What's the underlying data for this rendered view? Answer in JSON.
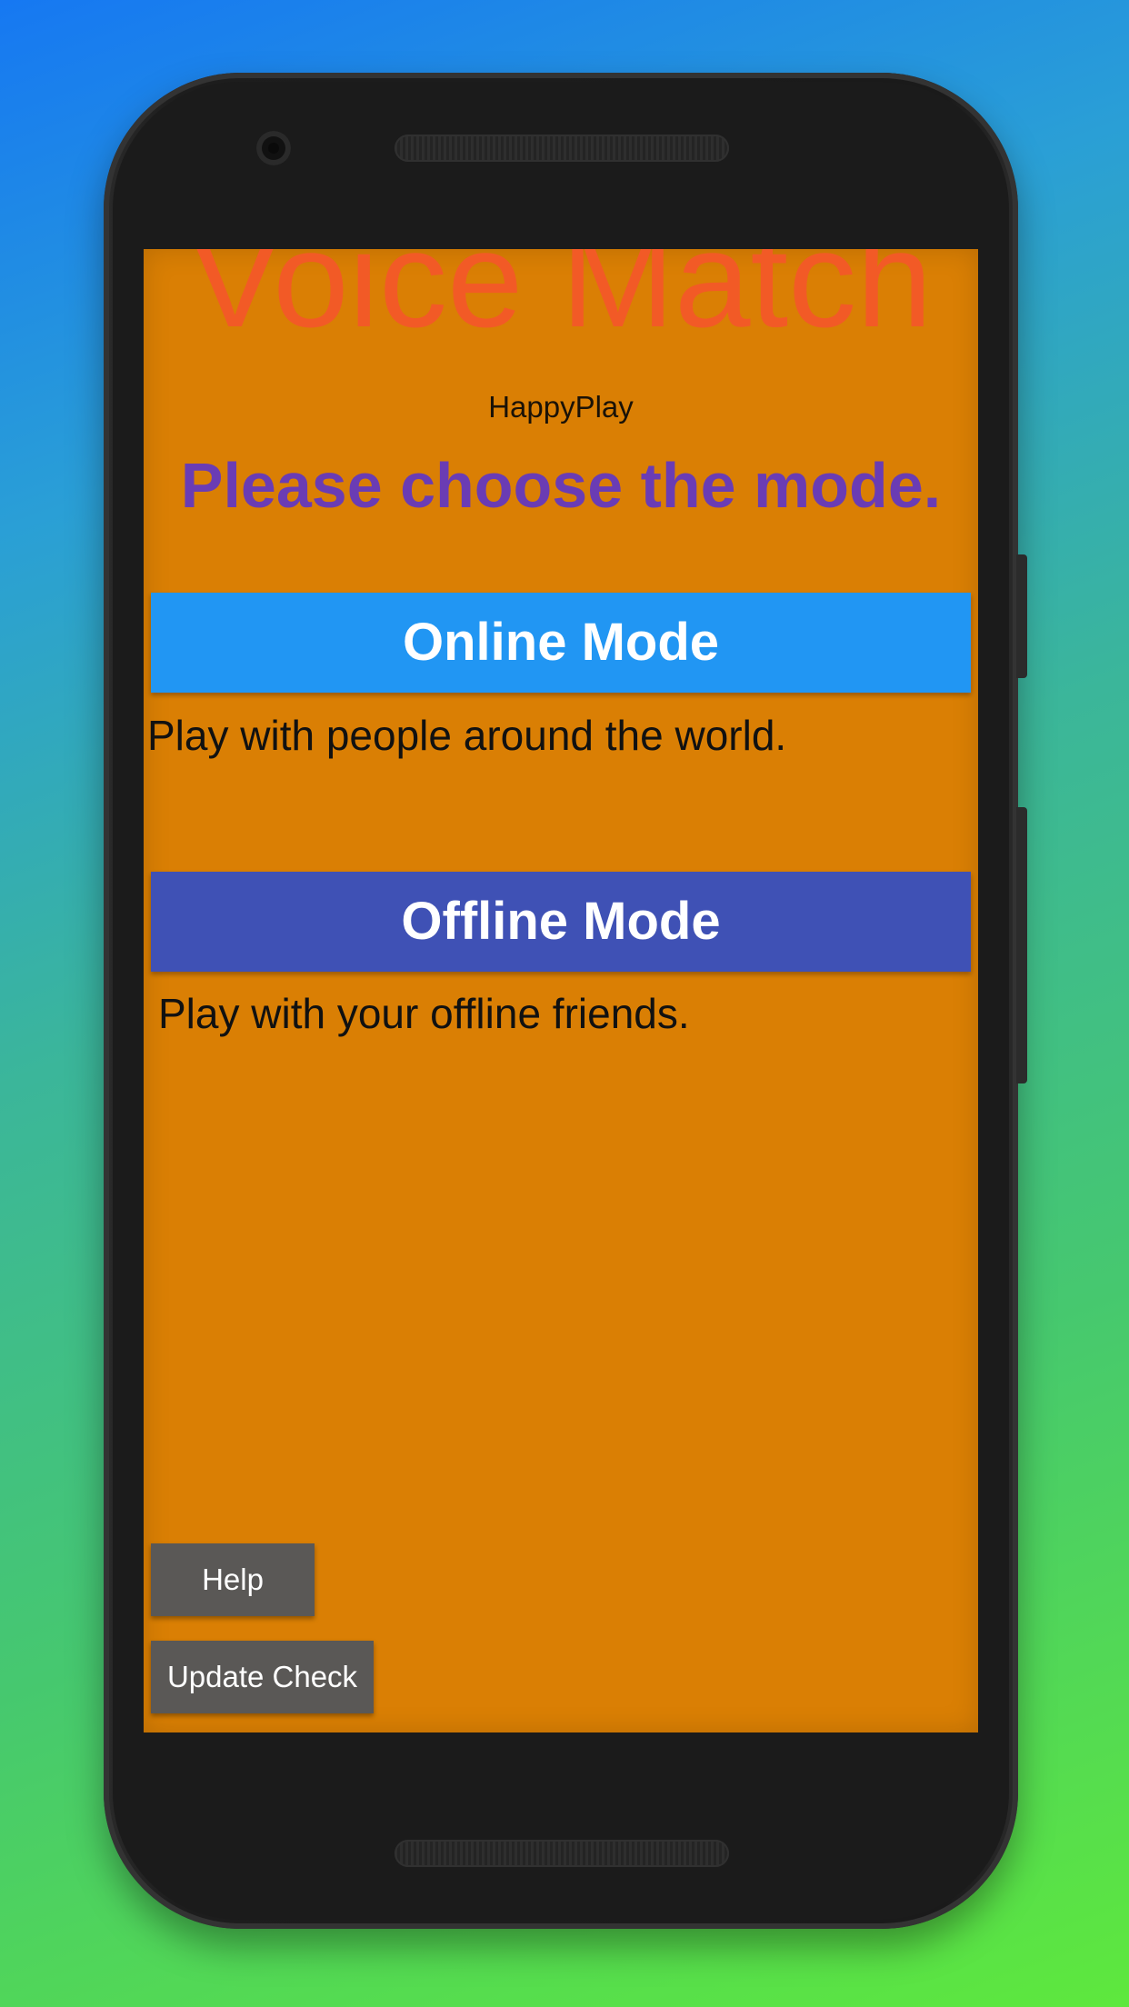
{
  "app": {
    "title": "Voice Match",
    "subtitle": "HappyPlay",
    "prompt": "Please choose the mode."
  },
  "modes": {
    "online": {
      "label": "Online Mode",
      "description": "Play with people around the world."
    },
    "offline": {
      "label": "Offline Mode",
      "description": "Play with your offline friends."
    }
  },
  "footer": {
    "help_label": "Help",
    "update_label": "Update Check"
  },
  "colors": {
    "screen_background": "#da7f04",
    "title": "#f25a26",
    "prompt": "#6a3cb4",
    "online_button": "#2196f3",
    "offline_button": "#3f51b5",
    "footer_button": "#5a5856"
  }
}
